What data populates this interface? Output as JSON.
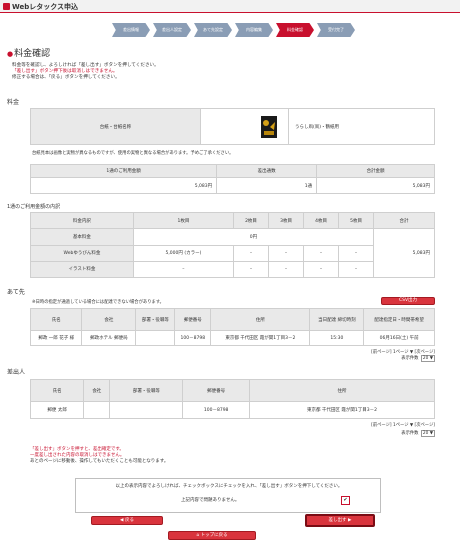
{
  "header": {
    "title": "Webレタックス申込"
  },
  "steps": [
    "差出情報",
    "差出人設定",
    "あて先設定",
    "内容編集",
    "料金確認",
    "受付完了"
  ],
  "active_step": 4,
  "page": {
    "title": "料金確認",
    "intro_1": "料金等を確認し、よろしければ「差し出す」ボタンを押してください。",
    "intro_2": "「差し出す」ボタン押下後は取消しはできません。",
    "intro_3": "修正する場合は、「戻る」ボタンを押してください。"
  },
  "fee": {
    "section_label": "料金",
    "label": "台紙・台紙名称",
    "name": "うらし凧(凧)・鶴紙用",
    "note": "台紙見本は画像と実物が異なるものですが、使用の実物と異なる場合があります。予めご了承ください。"
  },
  "totals": {
    "headers": [
      "1通のご利用金額",
      "差出通数",
      "合計金額"
    ],
    "values": [
      "5,083円",
      "1通",
      "5,083円"
    ]
  },
  "detail": {
    "section_label": "1通のご利用金額の内訳",
    "headers": [
      "料金内訳",
      "1枚目",
      "2枚目",
      "3枚目",
      "4枚目",
      "5枚目",
      "合計"
    ],
    "rows": [
      {
        "label": "基本料金",
        "cells": [
          "",
          "",
          "0円",
          "",
          ""
        ],
        "merged": "0円"
      },
      {
        "label": "Webゆうびん料金",
        "cells": [
          "5,000円 (カラー)",
          "–",
          "–",
          "–",
          "–"
        ]
      },
      {
        "label": "イラスト料金",
        "cells": [
          "–",
          "–",
          "–",
          "–",
          "–"
        ]
      }
    ],
    "sum": "5,083円"
  },
  "to": {
    "section_label": "あて先",
    "note": "※日時の指定が通過している場合には配達できない場合があります。",
    "csv_label": "CSV出力",
    "headers": [
      "氏名",
      "会社",
      "部署・役職等",
      "郵便番号",
      "住所",
      "当日配達 締切時刻",
      "配達指定日・時間帯希望"
    ],
    "row": [
      "郵政 一郎 花子 様",
      "郵政ホテル 郵便局",
      "",
      "100－8798",
      "東京都 千代田区 霞が関1丁目3－2",
      "15:30",
      "06月16日(土) 午前"
    ],
    "pager": "[前ページ] 1ページ ▼ [次ページ]",
    "per_page_label": "表示件数",
    "per_page": "20"
  },
  "from": {
    "section_label": "差出人",
    "headers": [
      "氏名",
      "会社",
      "部署・役職等",
      "郵便番号",
      "住所"
    ],
    "row": [
      "郵便 太郎",
      "",
      "",
      "100－8798",
      "東京都 千代田区 霞が関1丁目3－2"
    ],
    "pager": "[前ページ] 1ページ ▼ [次ページ]",
    "per_page_label": "表示件数",
    "per_page": "20"
  },
  "warning": {
    "line1": "「差し出す」ボタンを押すと、差出確定です。",
    "line2": "一度差し出された内容の取消しはできません。",
    "line3": "あとのページに移動後、操作してもいただくことも可能となります。"
  },
  "confirm": {
    "message": "以上の表示内容でよろしければ、チェックボックスにチェックを入れ、「差し出す」ボタンを押下してください。",
    "label": "上記内容で問題ありません。",
    "mark": "✔"
  },
  "buttons": {
    "back": "戻る",
    "submit": "差し出す",
    "top": "トップに戻る"
  },
  "colors": {
    "accent": "#c8102e",
    "step": "#8a9db5"
  }
}
